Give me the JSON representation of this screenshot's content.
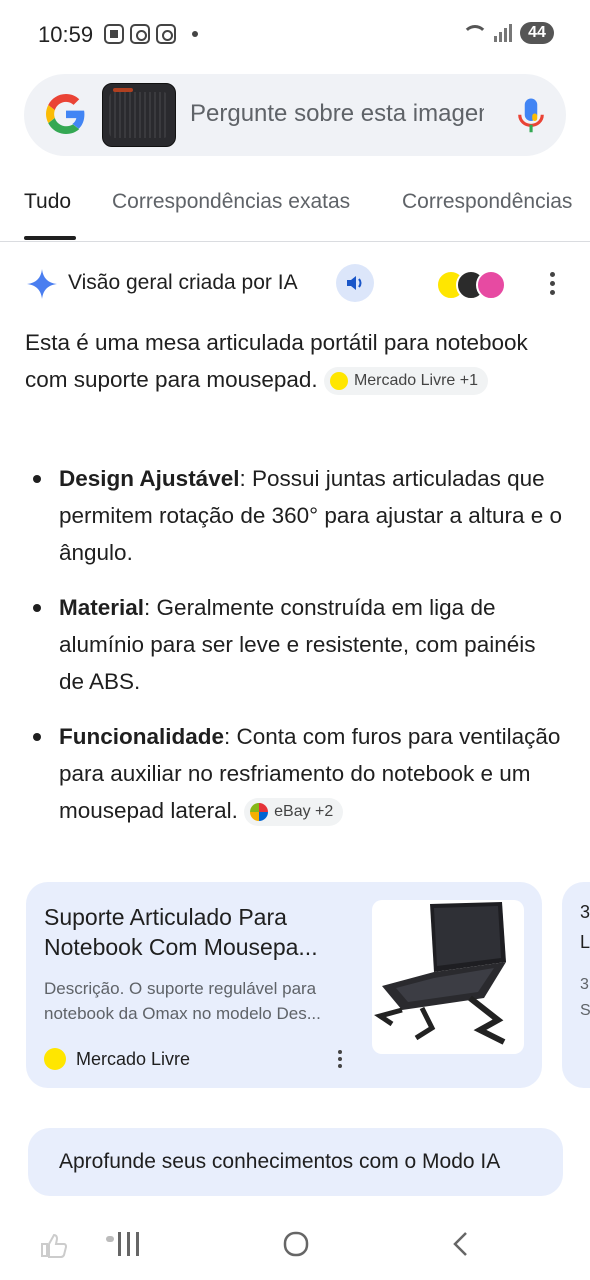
{
  "status_bar": {
    "time": "10:59",
    "battery": "44"
  },
  "search": {
    "placeholder": "Pergunte sobre esta imagem"
  },
  "tabs": [
    {
      "label": "Tudo",
      "active": true
    },
    {
      "label": "Correspondências exatas"
    },
    {
      "label": "Correspondências"
    }
  ],
  "ai_overview": {
    "title": "Visão geral criada por IA",
    "summary_text": "Esta é uma mesa articulada portátil para notebook com suporte para mousepad.",
    "summary_chip": "Mercado Livre +1",
    "bullets": [
      {
        "bold": "Design Ajustável",
        "text": ": Possui juntas articuladas que permitem rotação de 360° para ajustar a altura e o ângulo."
      },
      {
        "bold": "Material",
        "text": ": Geralmente construída em liga de alumínio para ser leve e resistente, com painéis de ABS."
      },
      {
        "bold": "Funcionalidade",
        "text": ": Conta com furos para ventilação para auxiliar no resfriamento do notebook e um mousepad lateral.",
        "chip": "eBay +2"
      }
    ]
  },
  "card": {
    "title": "Suporte Articulado Para Notebook Com Mousepa...",
    "description": "Descrição. O suporte regulável para notebook da Omax no modelo Des...",
    "source": "Mercado Livre",
    "peek_chars": [
      "3",
      "L",
      "3",
      "S"
    ]
  },
  "deep_dive": {
    "label": "Aprofunde seus conhecimentos com o Modo IA"
  },
  "colors": {
    "accent": "#4285f4",
    "card_bg": "#e8eefc",
    "search_bg": "#f0f2f6"
  }
}
